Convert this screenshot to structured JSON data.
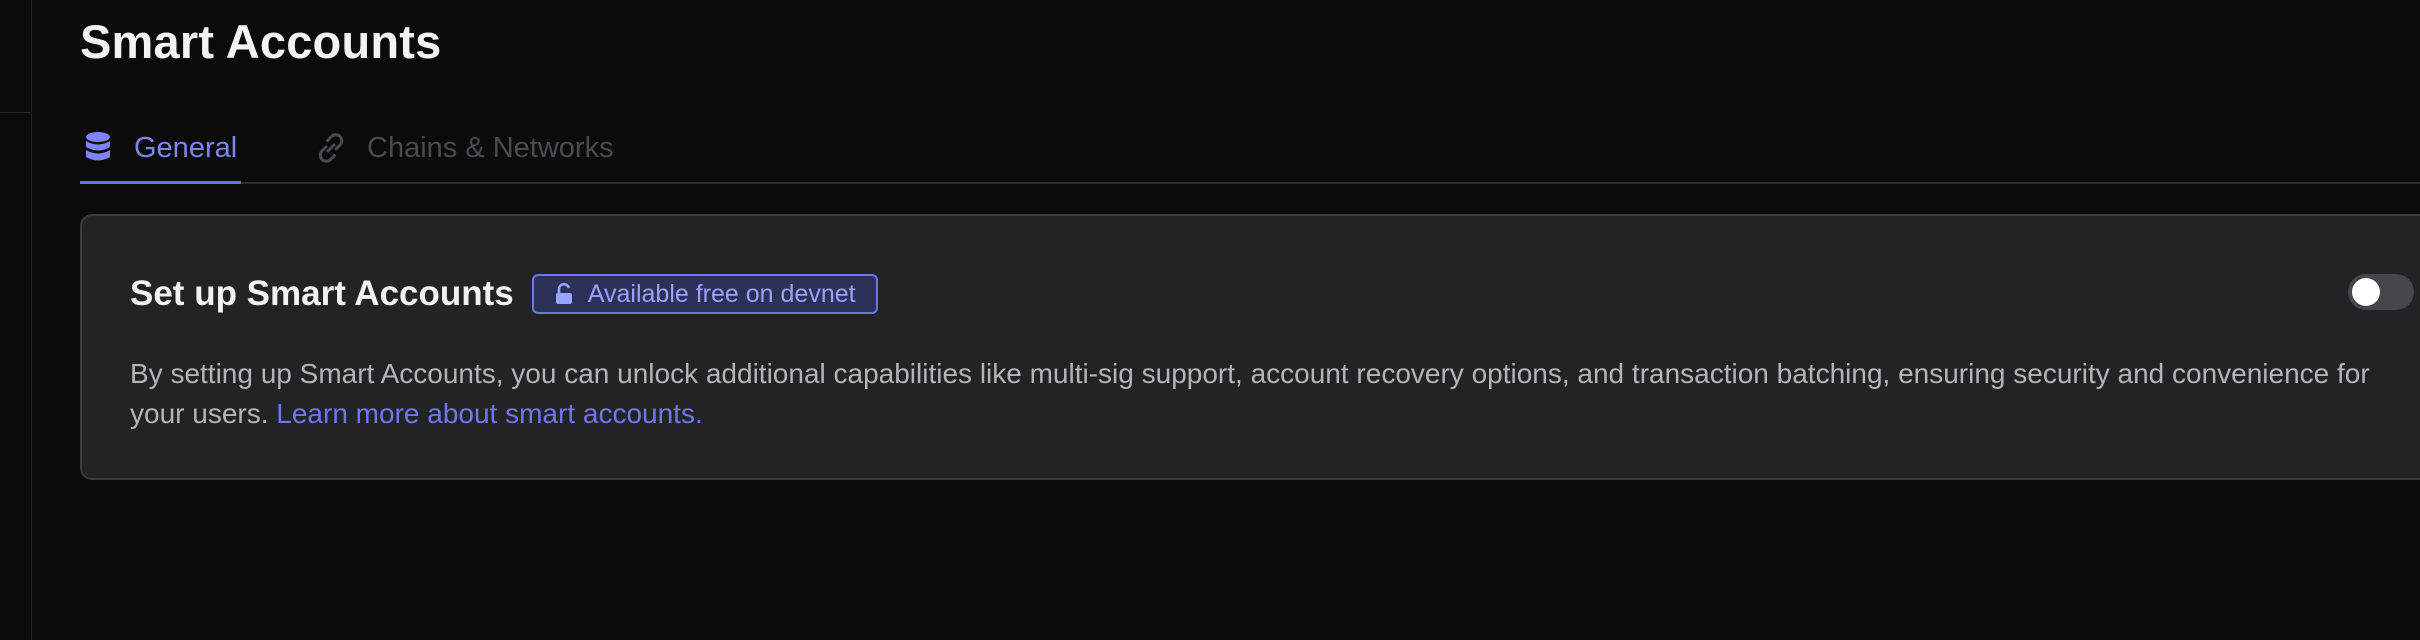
{
  "page": {
    "title": "Smart Accounts"
  },
  "tabs": [
    {
      "label": "General",
      "icon": "database-icon",
      "active": true
    },
    {
      "label": "Chains & Networks",
      "icon": "link-icon",
      "active": false
    }
  ],
  "card": {
    "title": "Set up Smart Accounts",
    "badge": {
      "label": "Available free on devnet",
      "icon": "unlock-icon"
    },
    "toggle": {
      "state": "off"
    },
    "description": "By setting up Smart Accounts, you can unlock additional capabilities like multi-sig support, account recovery options, and transaction batching, ensuring security and convenience for your users.",
    "link_text": "Learn more about smart accounts."
  },
  "colors": {
    "background": "#0b0b0c",
    "card": "#232326",
    "accent": "#6b72e6",
    "badge_text": "#9aa2ff",
    "muted_tab": "#4a4a50"
  }
}
